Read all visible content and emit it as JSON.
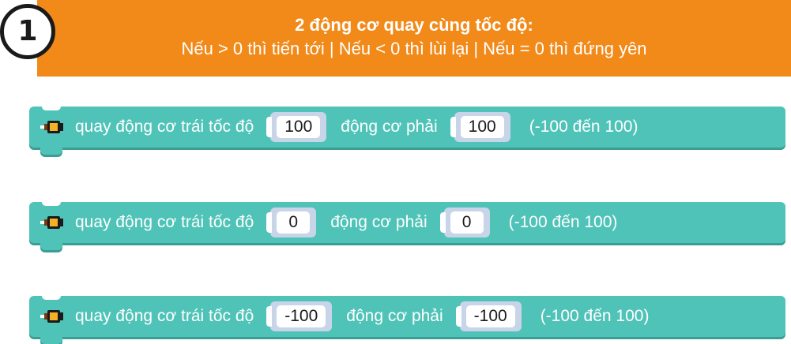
{
  "step": {
    "number": "1"
  },
  "banner": {
    "title": "2 động cơ quay cùng tốc độ:",
    "subtitle": "Nếu > 0 thì tiến tới | Nếu < 0 thì lùi lại | Nếu = 0 thì đứng yên"
  },
  "blocks": [
    {
      "left_label": "quay động cơ trái tốc độ",
      "left_value": "100",
      "right_label": "động cơ phải",
      "right_value": "100",
      "range": "(-100 đến 100)"
    },
    {
      "left_label": "quay động cơ trái tốc độ",
      "left_value": "0",
      "right_label": "động cơ phải",
      "right_value": "0",
      "range": "(-100 đến 100)"
    },
    {
      "left_label": "quay động cơ trái tốc độ",
      "left_value": "-100",
      "right_label": "động cơ phải",
      "right_value": "-100",
      "range": "(-100 đến 100)"
    }
  ],
  "icons": {
    "block_icon": "motor-icon",
    "block_color": "#4fc3b8",
    "banner_color": "#f28a1a",
    "slot_color": "#c8d4e8"
  }
}
